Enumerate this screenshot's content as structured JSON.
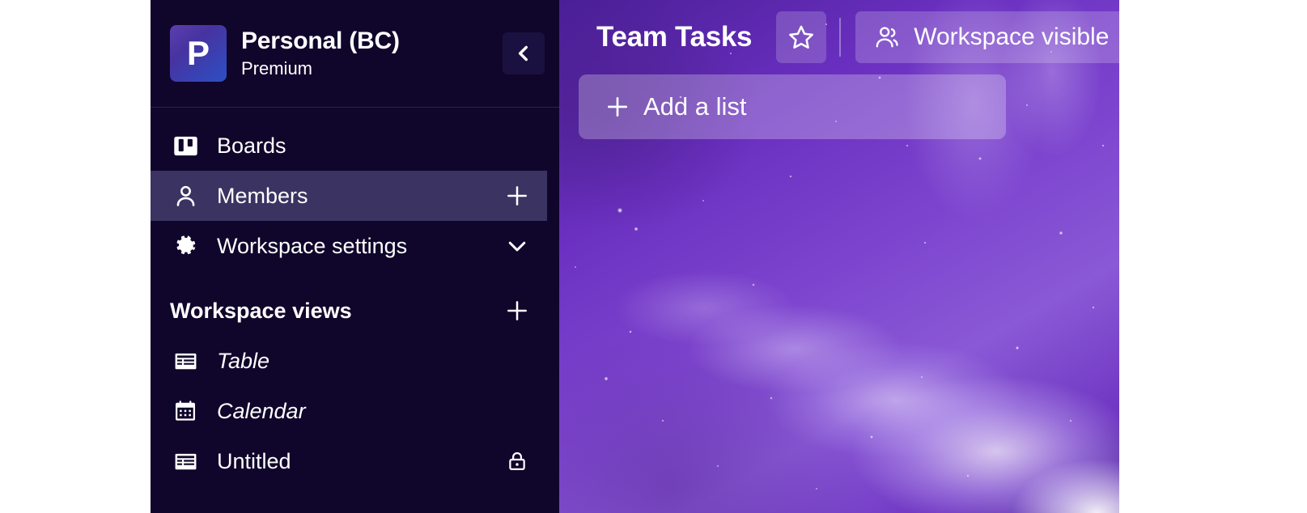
{
  "workspace": {
    "avatar_letter": "P",
    "name": "Personal (BC)",
    "plan": "Premium",
    "collapse_icon": "chevron-left-icon"
  },
  "sidebar": {
    "nav": [
      {
        "label": "Boards",
        "icon": "board-icon",
        "trailing": null,
        "selected": false,
        "italic": false
      },
      {
        "label": "Members",
        "icon": "person-icon",
        "trailing": "plus-icon",
        "selected": true,
        "italic": false
      },
      {
        "label": "Workspace settings",
        "icon": "gear-icon",
        "trailing": "chevron-down-icon",
        "selected": false,
        "italic": false
      }
    ],
    "views_section": {
      "title": "Workspace views",
      "add_icon": "plus-icon",
      "items": [
        {
          "label": "Table",
          "icon": "table-icon",
          "trailing": null,
          "italic": true
        },
        {
          "label": "Calendar",
          "icon": "calendar-icon",
          "trailing": null,
          "italic": true
        },
        {
          "label": "Untitled",
          "icon": "table-icon",
          "trailing": "lock-icon",
          "italic": false
        }
      ]
    }
  },
  "board": {
    "title": "Team Tasks",
    "star_icon": "star-outline-icon",
    "visibility": {
      "icon": "people-icon",
      "label": "Workspace visible"
    },
    "add_list": {
      "icon": "plus-icon",
      "label": "Add a list"
    },
    "background": "galaxy-nebula-purple"
  },
  "colors": {
    "sidebar_bg": "#10062b",
    "sidebar_selected": "#3b3361",
    "sidebar_divider": "#2c2350",
    "logo_gradient_from": "#5c3fae",
    "logo_gradient_to": "#2d4fc4",
    "board_purple": "#6a34c4",
    "text_primary": "#ffffff",
    "page_bg": "#ffffff"
  }
}
